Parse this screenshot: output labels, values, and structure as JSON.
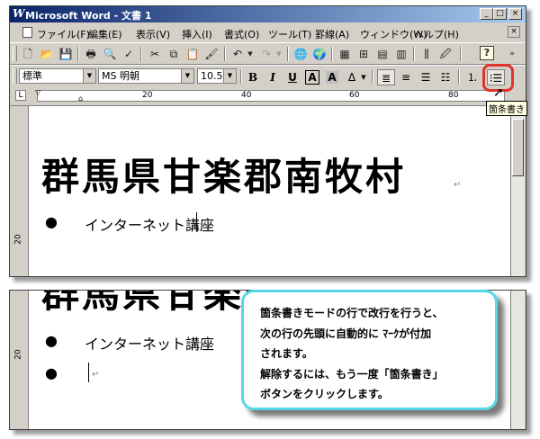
{
  "window": {
    "app_icon": "W",
    "title": "Microsoft Word - 文書 1",
    "minimize": "_",
    "maximize": "□",
    "close": "×"
  },
  "menu": {
    "items": [
      "ファイル(F)",
      "編集(E)",
      "表示(V)",
      "挿入(I)",
      "書式(O)",
      "ツール(T)",
      "罫線(A)",
      "ウィンドウ(W)",
      "ヘルプ(H)"
    ],
    "close": "×"
  },
  "standard_toolbar": {
    "icons": [
      "new-document-icon",
      "open-folder-icon",
      "save-icon",
      "print-icon",
      "print-preview-icon",
      "spelling-icon",
      "cut-icon",
      "copy-icon",
      "paste-icon",
      "format-painter-icon",
      "undo-icon",
      "redo-icon",
      "insert-hyperlink-icon",
      "web-toolbar-icon",
      "tables-and-borders-icon",
      "insert-table-icon",
      "insert-excel-icon",
      "columns-icon",
      "drawing-icon",
      "document-map-icon",
      "help-icon"
    ]
  },
  "formatting_toolbar": {
    "style": "標準",
    "font": "MS 明朝",
    "size": "10.5",
    "bold": "B",
    "italic": "I",
    "underline": "U",
    "char_border": "A",
    "char_shading": "A",
    "numbering_tooltip": "箇条書き"
  },
  "ruler": {
    "ticks": [
      "20",
      "40",
      "60",
      "80"
    ],
    "vertical_tick": "20"
  },
  "document": {
    "heading": "群馬県甘楽郡南牧村",
    "bullet": "●",
    "list_item": "インターネット講座",
    "para_mark": "↵",
    "heading_partial": "群馬県甘楽郡"
  },
  "callout": {
    "lines": [
      "箇条書きモードの行で改行を行うと、",
      "次の行の先頭に自動的に ﾏｰｸが付加",
      "されます。",
      "解除するには、もう一度「箇条書き」",
      "ボタンをクリックします。"
    ]
  },
  "colors": {
    "titlebar_start": "#0a246a",
    "titlebar_end": "#a6caf0",
    "highlight": "#e0332a",
    "callout_border": "#58d8e6"
  }
}
